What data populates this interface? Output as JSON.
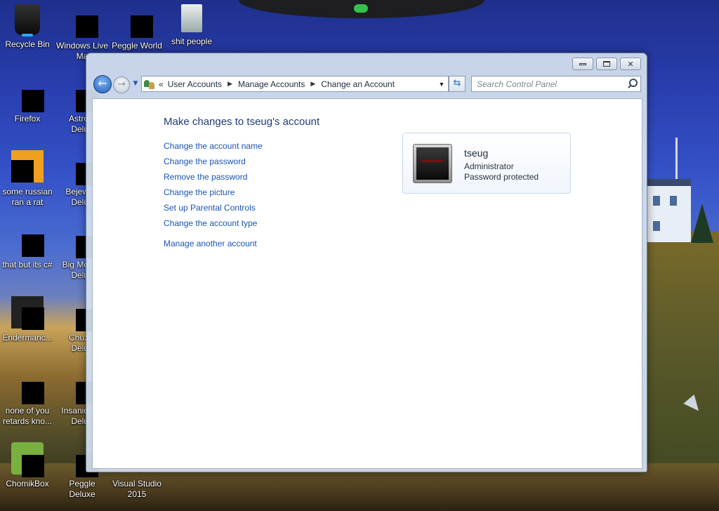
{
  "desktop": {
    "icons": [
      {
        "label": "Recycle Bin",
        "icon": "recycle-bin-icon"
      },
      {
        "label": "Windows Live\nMa",
        "icon": "windows-live-icon"
      },
      {
        "label": "Peggle World",
        "icon": "peggle-icon"
      },
      {
        "label": "shit people",
        "icon": "folder-icon"
      },
      {
        "label": "Firefox",
        "icon": "firefox-icon"
      },
      {
        "label": "Astro\nDelu",
        "icon": "game-icon"
      },
      {
        "label": "some russian\nran a rat",
        "icon": "java-icon"
      },
      {
        "label": "Bejew\nDelu",
        "icon": "game-icon"
      },
      {
        "label": "that but its c#",
        "icon": "files-icon"
      },
      {
        "label": "Big Mo\nDelu",
        "icon": "game-icon"
      },
      {
        "label": "Endermanc...",
        "icon": "app-icon"
      },
      {
        "label": "Chuz\nDelu",
        "icon": "game-icon"
      },
      {
        "label": "none of you\nretards kno...",
        "icon": "app-icon"
      },
      {
        "label": "Insaniq\nDelu",
        "icon": "game-icon"
      },
      {
        "label": "ChomikBox",
        "icon": "chomikbox-icon"
      },
      {
        "label": "Peggle Deluxe",
        "icon": "peggle-icon"
      },
      {
        "label": "Visual Studio\n2015",
        "icon": "visual-studio-icon"
      }
    ]
  },
  "window": {
    "controls": {
      "minimize": "minimize-icon",
      "maximize": "maximize-icon",
      "close": "close-icon"
    },
    "address": {
      "lead": "«",
      "crumbs": [
        "User Accounts",
        "Manage Accounts",
        "Change an Account"
      ]
    },
    "search": {
      "placeholder": "Search Control Panel"
    },
    "page": {
      "title": "Make changes to tseug's account",
      "links": [
        "Change the account name",
        "Change the password",
        "Remove the password",
        "Change the picture",
        "Set up Parental Controls",
        "Change the account type"
      ],
      "secondary_link": "Manage another account"
    },
    "account": {
      "name": "tseug",
      "type": "Administrator",
      "status": "Password protected"
    }
  }
}
